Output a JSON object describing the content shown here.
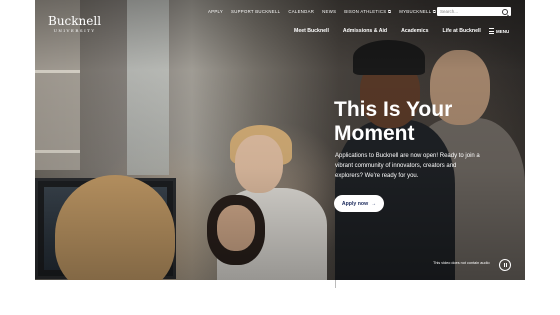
{
  "logo": {
    "name": "Bucknell",
    "sub": "UNIVERSITY"
  },
  "utility_nav": [
    "APPLY",
    "SUPPORT BUCKNELL",
    "CALENDAR",
    "NEWS",
    "BISON ATHLETICS ⧉",
    "MYBUCKNELL ⧉"
  ],
  "search": {
    "placeholder": "Search..."
  },
  "main_nav": [
    "Meet Bucknell",
    "Admissions & Aid",
    "Academics",
    "Life at Bucknell"
  ],
  "menu_label": "MENU",
  "hero": {
    "headline": "This Is Your Moment",
    "subtext": "Applications to Bucknell are now open! Ready to join a vibrant community of innovators, creators and explorers? We're ready for you.",
    "cta": "Apply now",
    "cta_arrow": "→",
    "audio_note": "This video does not contain audio"
  },
  "icons": [
    "search-icon",
    "menu-icon",
    "pause-icon",
    "arrow-right-icon",
    "external-link-icon"
  ]
}
